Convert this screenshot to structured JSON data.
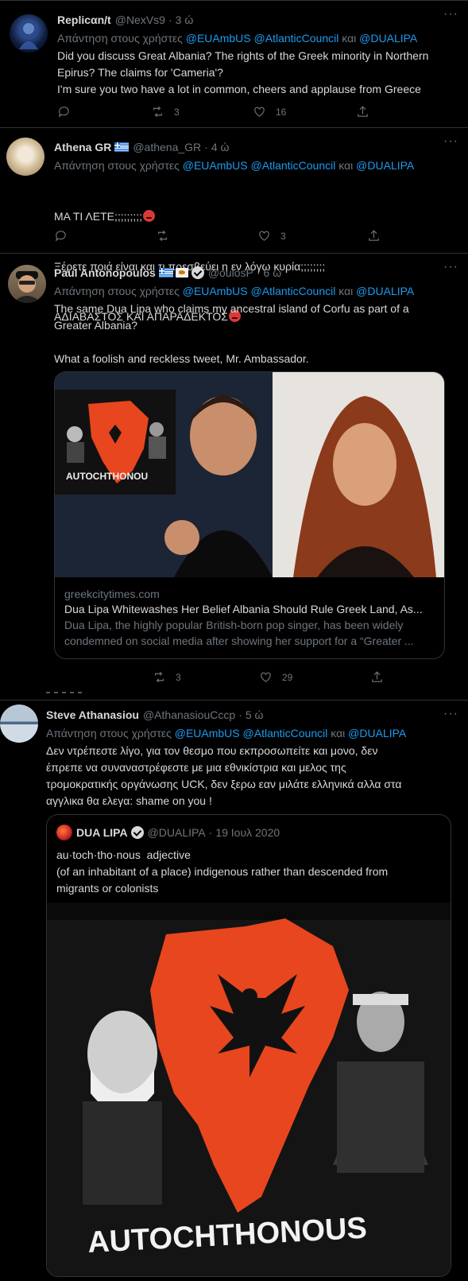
{
  "reply_prefix": "Απάντηση στους χρήστες",
  "reply_and": "και",
  "mentions": [
    "@EUAmbUS",
    "@AtlanticCouncil",
    "@DUALIPA"
  ],
  "more_label": "···",
  "tweets": [
    {
      "name": "Replicαn/t",
      "handle": "@NexVs9",
      "time": "3 ώ",
      "text": "Did you discuss Great Albania? The rights of the Greek minority in Northern\nEpirus? The claims for 'Cameria'?\nI'm sure you two have a lot in common, cheers and applause from Greece",
      "retweets": "3",
      "likes": "16"
    },
    {
      "name": "Athena GR",
      "handle": "@athena_GR",
      "time": "4 ώ",
      "text_line1": "ΜΑ ΤΙ ΛΕΤΕ;;;;;;;;;",
      "text_line2": "Ξέρετε ποιά είναι και τι πρεσβεύει η εν λόγω κυρία;;;;;;;;",
      "text_line3": "ΑΔΙΑΒΑΣΤΟΣ ΚΑΙ ΑΠΑΡΑΔΕΚΤΟΣ",
      "retweets": "",
      "likes": "3"
    },
    {
      "name": "Paul Antonopoulos",
      "handle": "@oulosP",
      "time": "6 ώ",
      "text": "The same Dua Lipa who claims my ancestral island of Corfu as part of a\nGreater Albania?\n\nWhat a foolish and reckless tweet, Mr. Ambassador.",
      "card": {
        "domain": "greekcitytimes.com",
        "title": "Dua Lipa Whitewashes Her Belief Albania Should Rule Greek Land, As...",
        "desc_line1": "Dua Lipa, the highly popular British-born pop singer, has been widely",
        "desc_line2": "condemned on social media after showing her support for a “Greater ...",
        "banner_text": "AUTOCHTHONOU"
      },
      "retweets": "3",
      "likes": "29"
    },
    {
      "name": "Steve Athanasiou",
      "handle": "@AthanasiouCccp",
      "time": "5 ώ",
      "text": "Δεν ντρέπεστε λίγο, για τον θεσμο που εκπροσωπείτε και μονο, δεν\nέπρεπε να συναναστρέφεστε με μια εθνικίστρια και μελος της\nτρομοκρατικής οργάνωσης UCK, δεν ξερω εαν μιλάτε ελληνικά αλλα στα\nαγγλικα θα ελεγα: shame on you !",
      "quote": {
        "name": "DUA LIPA",
        "handle": "@DUALIPA",
        "date": "19 Ιουλ 2020",
        "text": "au·toch·tho·nous  adjective\n(of an inhabitant of a place) indigenous rather than descended from\nmigrants or colonists",
        "banner_text": "AUTOCHTHONOUS"
      }
    }
  ],
  "colors": {
    "background": "#000000",
    "link": "#1d9bf0",
    "muted": "#6e767d",
    "text": "#d9d9d9",
    "border": "#2f3336",
    "flag_red": "#e8461e"
  },
  "icons": [
    "reply-icon",
    "retweet-icon",
    "like-icon",
    "share-icon",
    "more-icon",
    "verified-icon",
    "greek-flag-icon",
    "cyprus-flag-icon",
    "angry-emoji-icon"
  ]
}
